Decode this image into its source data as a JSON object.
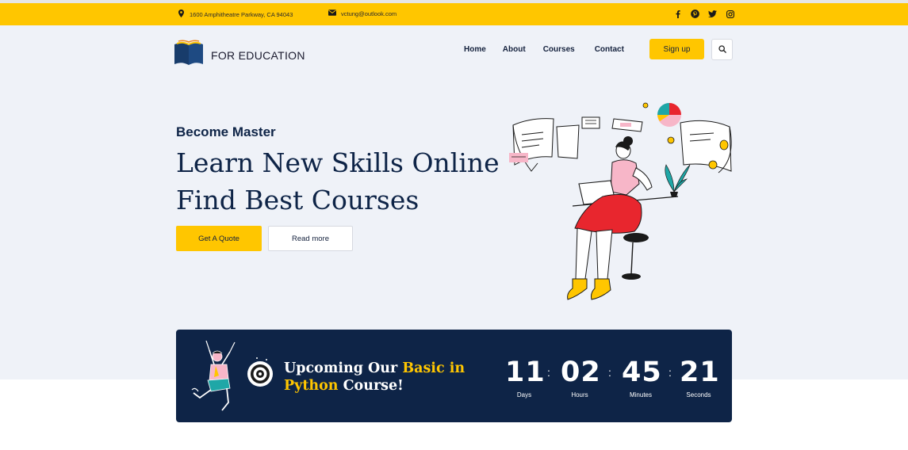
{
  "topbar": {
    "address": "1600 Amphitheatre Parkway, CA 94043",
    "email": "vctung@outlook.com",
    "social_icons": [
      "facebook-icon",
      "pinterest-icon",
      "twitter-icon",
      "instagram-icon"
    ]
  },
  "header": {
    "logo_text": "FOR EDUCATION",
    "nav": [
      "Home",
      "About",
      "Courses",
      "Contact"
    ],
    "signup_label": "Sign up",
    "search_icon": "search-icon"
  },
  "hero": {
    "eyebrow": "Become Master",
    "headline_line1": "Learn New Skills Online",
    "headline_line2": "Find Best Courses",
    "primary_button": "Get A Quote",
    "secondary_button": "Read more"
  },
  "banner": {
    "title_part1": "Upcoming Our ",
    "title_highlight1": "Basic in",
    "title_highlight2": "Python",
    "title_part2": " Course!",
    "countdown": [
      {
        "value": "11",
        "label": "Days"
      },
      {
        "value": "02",
        "label": "Hours"
      },
      {
        "value": "45",
        "label": "Minutes"
      },
      {
        "value": "21",
        "label": "Seconds"
      }
    ],
    "separator": ":"
  },
  "colors": {
    "accent": "#ffc600",
    "navy": "#0e2447",
    "hero_bg": "#eff2f8"
  }
}
